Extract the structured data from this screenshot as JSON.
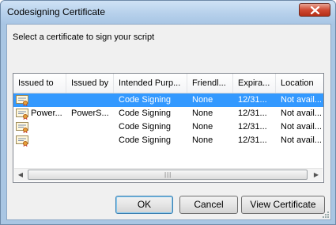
{
  "window": {
    "title": "Codesigning Certificate",
    "close_icon": "close-x-icon"
  },
  "prompt": "Select a certificate to sign your script",
  "list": {
    "columns": [
      "Issued to",
      "Issued by",
      "Intended Purp...",
      "Friendl...",
      "Expira...",
      "Location"
    ],
    "rows": [
      {
        "issued_to": "",
        "issued_by": "",
        "purpose": "Code Signing",
        "friendly": "None",
        "expiration": "12/31...",
        "location": "Not avail...",
        "icon": "certificate-icon",
        "selected": true
      },
      {
        "issued_to": "Power...",
        "issued_by": "PowerS...",
        "purpose": "Code Signing",
        "friendly": "None",
        "expiration": "12/31...",
        "location": "Not avail...",
        "icon": "certificate-icon",
        "selected": false
      },
      {
        "issued_to": "",
        "issued_by": "",
        "purpose": "Code Signing",
        "friendly": "None",
        "expiration": "12/31...",
        "location": "Not avail...",
        "icon": "certificate-icon",
        "selected": false
      },
      {
        "issued_to": "",
        "issued_by": "",
        "purpose": "Code Signing",
        "friendly": "None",
        "expiration": "12/31...",
        "location": "Not avail...",
        "icon": "certificate-icon",
        "selected": false
      }
    ]
  },
  "scrollbar": {
    "left_arrow": "◀",
    "right_arrow": "▶",
    "grip": "|||"
  },
  "buttons": {
    "ok": "OK",
    "cancel": "Cancel",
    "view": "View Certificate"
  },
  "colors": {
    "selection": "#3399ff",
    "titlebar": "#b6d0eb",
    "close": "#cf4a33"
  }
}
